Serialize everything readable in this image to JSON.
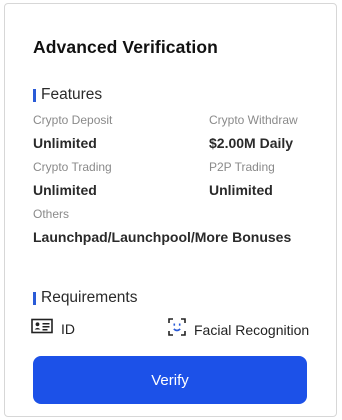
{
  "title": "Advanced Verification",
  "features": {
    "heading": "Features",
    "items": [
      {
        "label": "Crypto Deposit",
        "value": "Unlimited"
      },
      {
        "label": "Crypto Withdraw",
        "value": "$2.00M Daily"
      },
      {
        "label": "Crypto Trading",
        "value": "Unlimited"
      },
      {
        "label": "P2P Trading",
        "value": "Unlimited"
      },
      {
        "label": "Others",
        "value": "Launchpad/Launchpool/More Bonuses"
      }
    ]
  },
  "requirements": {
    "heading": "Requirements",
    "items": [
      {
        "icon": "id-card-icon",
        "label": "ID"
      },
      {
        "icon": "face-scan-icon",
        "label": "Facial Recognition"
      }
    ]
  },
  "button": {
    "label": "Verify"
  },
  "colors": {
    "accent": "#1c51e8",
    "section_bar": "#2a5bd7"
  }
}
